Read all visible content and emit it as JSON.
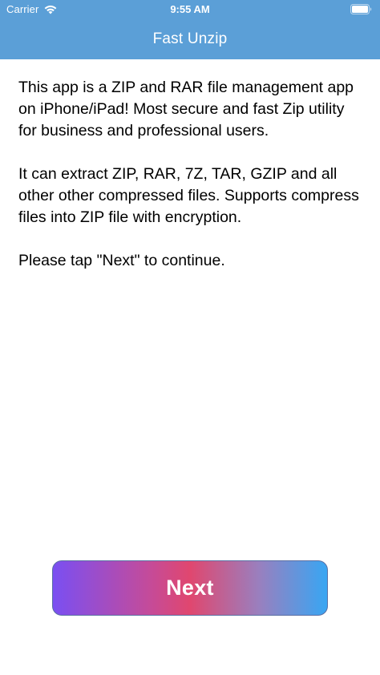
{
  "status_bar": {
    "carrier": "Carrier",
    "time": "9:55 AM",
    "wifi_icon": "wifi-icon",
    "battery_icon": "battery-full-icon"
  },
  "nav": {
    "title": "Fast Unzip"
  },
  "content": {
    "paragraphs": [
      "This app is a ZIP and RAR file management app on iPhone/iPad! Most secure and fast Zip utility for business and professional users.",
      "It can extract ZIP, RAR, 7Z, TAR, GZIP and all other other compressed files. Supports compress files into ZIP file with encryption.",
      "Please tap \"Next\" to continue."
    ]
  },
  "next_button": {
    "label": "Next"
  },
  "colors": {
    "header_background": "#5b9fd7",
    "button_gradient_start": "#7a4ff2",
    "button_gradient_mid": "#e0476f",
    "button_gradient_end": "#38a6f3",
    "text": "#000000",
    "header_text": "#ffffff"
  }
}
